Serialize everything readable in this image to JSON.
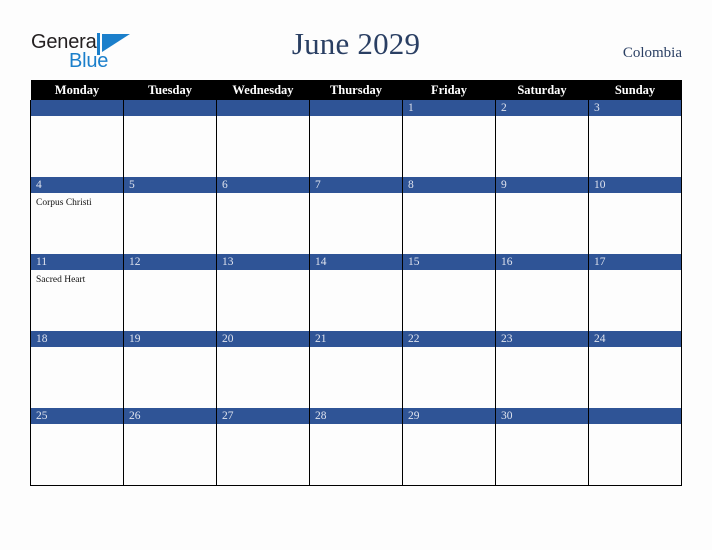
{
  "brand": {
    "line1": "General",
    "line2": "Blue",
    "mark_icon": "blue-triangle-logo-mark",
    "mark_color": "#1b7fcb"
  },
  "header": {
    "title": "June 2029",
    "country": "Colombia",
    "title_color": "#2a3f63"
  },
  "colors": {
    "header_row_bg": "#000000",
    "day_bar_bg": "#2f5496",
    "day_number_text": "#dfe3ee",
    "cell_bg": "#fdfdfd",
    "page_bg": "#fdfdfd",
    "grid_line": "#000000"
  },
  "weekday_headers": [
    "Monday",
    "Tuesday",
    "Wednesday",
    "Thursday",
    "Friday",
    "Saturday",
    "Sunday"
  ],
  "weeks": [
    [
      {
        "day": "",
        "blank": true,
        "events": []
      },
      {
        "day": "",
        "blank": true,
        "events": []
      },
      {
        "day": "",
        "blank": true,
        "events": []
      },
      {
        "day": "",
        "blank": true,
        "events": []
      },
      {
        "day": "1",
        "blank": false,
        "events": []
      },
      {
        "day": "2",
        "blank": false,
        "events": []
      },
      {
        "day": "3",
        "blank": false,
        "events": []
      }
    ],
    [
      {
        "day": "4",
        "blank": false,
        "events": [
          "Corpus Christi"
        ]
      },
      {
        "day": "5",
        "blank": false,
        "events": []
      },
      {
        "day": "6",
        "blank": false,
        "events": []
      },
      {
        "day": "7",
        "blank": false,
        "events": []
      },
      {
        "day": "8",
        "blank": false,
        "events": []
      },
      {
        "day": "9",
        "blank": false,
        "events": []
      },
      {
        "day": "10",
        "blank": false,
        "events": []
      }
    ],
    [
      {
        "day": "11",
        "blank": false,
        "events": [
          "Sacred Heart"
        ]
      },
      {
        "day": "12",
        "blank": false,
        "events": []
      },
      {
        "day": "13",
        "blank": false,
        "events": []
      },
      {
        "day": "14",
        "blank": false,
        "events": []
      },
      {
        "day": "15",
        "blank": false,
        "events": []
      },
      {
        "day": "16",
        "blank": false,
        "events": []
      },
      {
        "day": "17",
        "blank": false,
        "events": []
      }
    ],
    [
      {
        "day": "18",
        "blank": false,
        "events": []
      },
      {
        "day": "19",
        "blank": false,
        "events": []
      },
      {
        "day": "20",
        "blank": false,
        "events": []
      },
      {
        "day": "21",
        "blank": false,
        "events": []
      },
      {
        "day": "22",
        "blank": false,
        "events": []
      },
      {
        "day": "23",
        "blank": false,
        "events": []
      },
      {
        "day": "24",
        "blank": false,
        "events": []
      }
    ],
    [
      {
        "day": "25",
        "blank": false,
        "events": []
      },
      {
        "day": "26",
        "blank": false,
        "events": []
      },
      {
        "day": "27",
        "blank": false,
        "events": []
      },
      {
        "day": "28",
        "blank": false,
        "events": []
      },
      {
        "day": "29",
        "blank": false,
        "events": []
      },
      {
        "day": "30",
        "blank": false,
        "events": []
      },
      {
        "day": "",
        "blank": true,
        "events": []
      }
    ]
  ]
}
